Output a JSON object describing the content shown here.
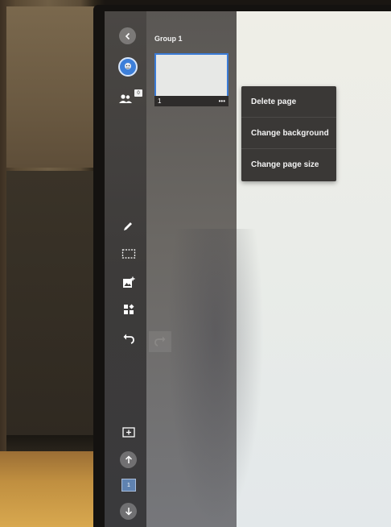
{
  "pages_panel": {
    "group_title": "Group 1",
    "pages": [
      {
        "number": "1",
        "more": "•••"
      }
    ]
  },
  "context_menu": {
    "items": [
      {
        "label": "Delete page"
      },
      {
        "label": "Change background"
      },
      {
        "label": "Change page size"
      }
    ]
  },
  "rail": {
    "participants_count": "0",
    "current_page": "1"
  },
  "icons": {
    "back": "chevron-left-icon",
    "avatar": "avatar-icon",
    "participants": "people-icon",
    "pen": "pen-icon",
    "select": "lasso-select-icon",
    "insert_image": "image-add-icon",
    "widgets": "widgets-icon",
    "undo": "undo-icon",
    "redo": "redo-icon",
    "add_page": "add-page-icon",
    "page_up": "arrow-up-icon",
    "page_down": "arrow-down-icon"
  },
  "colors": {
    "accent": "#3b7bd6",
    "menu_bg": "#3a3836"
  }
}
